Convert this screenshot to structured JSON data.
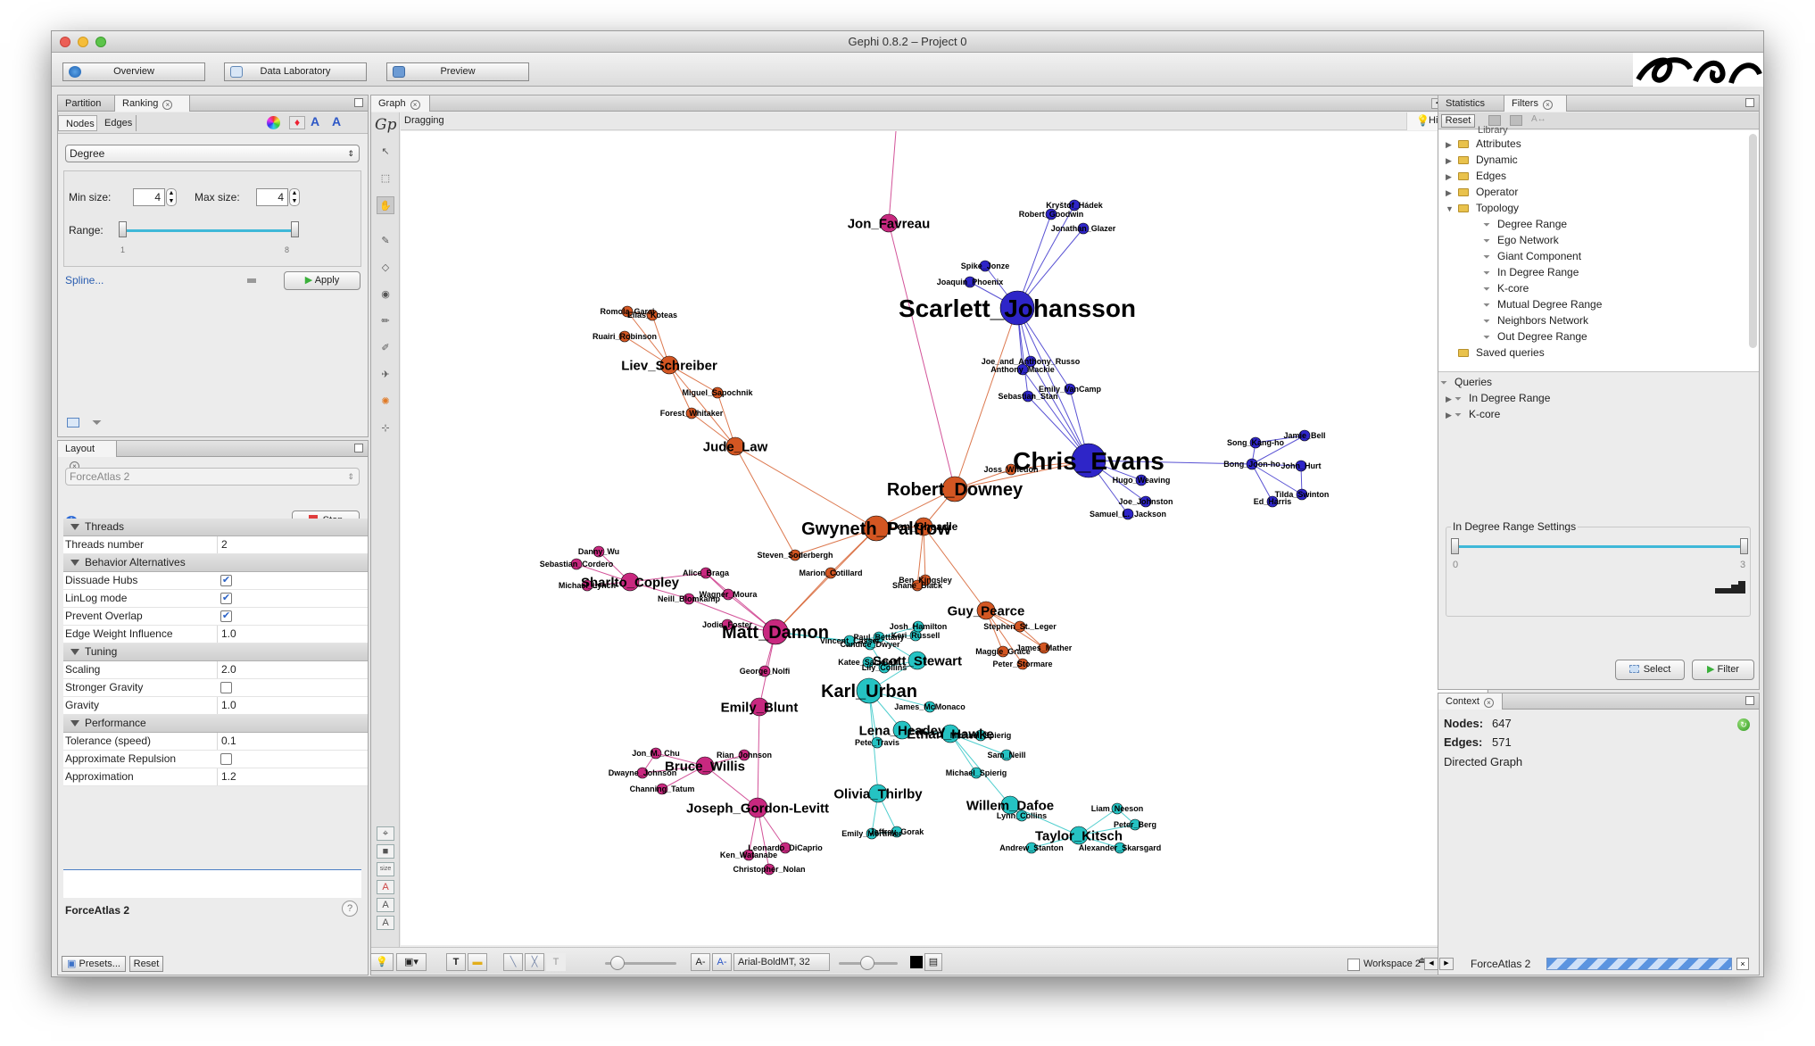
{
  "window": {
    "title": "Gephi 0.8.2 – Project 0"
  },
  "toolbar": {
    "overview": "Overview",
    "data_lab": "Data Laboratory",
    "preview": "Preview"
  },
  "left_top": {
    "tab_partition": "Partition",
    "tab_ranking": "Ranking",
    "subtab_nodes": "Nodes",
    "subtab_edges": "Edges",
    "ranking_select": "Degree",
    "min_size_label": "Min size:",
    "min_size_value": "4",
    "max_size_label": "Max size:",
    "max_size_value": "4",
    "range_label": "Range:",
    "range_min": "1",
    "range_max": "8",
    "spline": "Spline...",
    "apply": "Apply"
  },
  "layout": {
    "tab": "Layout",
    "algorithm": "ForceAtlas 2",
    "stop": "Stop",
    "rows": [
      {
        "kind": "cat",
        "k": "Threads"
      },
      {
        "kind": "prop",
        "k": "Threads number",
        "v": "2"
      },
      {
        "kind": "cat",
        "k": "Behavior Alternatives"
      },
      {
        "kind": "check",
        "k": "Dissuade Hubs",
        "v": "✔"
      },
      {
        "kind": "check",
        "k": "LinLog mode",
        "v": "✔"
      },
      {
        "kind": "check",
        "k": "Prevent Overlap",
        "v": "✔"
      },
      {
        "kind": "prop",
        "k": "Edge Weight Influence",
        "v": "1.0"
      },
      {
        "kind": "cat",
        "k": "Tuning"
      },
      {
        "kind": "prop",
        "k": "Scaling",
        "v": "2.0"
      },
      {
        "kind": "check",
        "k": "Stronger Gravity",
        "v": ""
      },
      {
        "kind": "prop",
        "k": "Gravity",
        "v": "1.0"
      },
      {
        "kind": "cat",
        "k": "Performance"
      },
      {
        "kind": "prop",
        "k": "Tolerance (speed)",
        "v": "0.1"
      },
      {
        "kind": "check",
        "k": "Approximate Repulsion",
        "v": ""
      },
      {
        "kind": "prop",
        "k": "Approximation",
        "v": "1.2"
      }
    ],
    "desc_title": "ForceAtlas 2",
    "presets": "Presets...",
    "reset": "Reset"
  },
  "graph": {
    "tab": "Graph",
    "mode": "Dragging",
    "hierarchy": "Hierarchy",
    "font": "Arial-BoldMT, 32",
    "colors": {
      "magenta": "#c8287f",
      "orange": "#d35622",
      "blue": "#2e25c8",
      "cyan": "#25c3c3"
    },
    "nodes": [
      [
        "Jon_Favreau",
        994,
        254,
        10,
        "magenta",
        15
      ],
      [
        "Scarlett_Johansson",
        1138,
        349,
        19,
        "blue",
        28
      ],
      [
        "Kryštof_Hádek",
        1202,
        234,
        6,
        "blue",
        9
      ],
      [
        "Robert_Goodwin",
        1176,
        244,
        6,
        "blue",
        9
      ],
      [
        "Jonathan_Glazer",
        1212,
        260,
        6,
        "blue",
        9
      ],
      [
        "Spike_Jonze",
        1102,
        302,
        6,
        "blue",
        9
      ],
      [
        "Joaquin_Phoenix",
        1085,
        320,
        6,
        "blue",
        9
      ],
      [
        "Joe_and_Anthony_Russo",
        1153,
        409,
        6,
        "blue",
        9
      ],
      [
        "Anthony_Mackie",
        1144,
        418,
        6,
        "blue",
        9
      ],
      [
        "Emily_VanCamp",
        1197,
        440,
        6,
        "blue",
        9
      ],
      [
        "Sebastian_Stan",
        1150,
        448,
        6,
        "blue",
        9
      ],
      [
        "Chris_Evans",
        1218,
        520,
        19,
        "blue",
        28
      ],
      [
        "Song_Kang-ho",
        1405,
        500,
        6,
        "blue",
        9
      ],
      [
        "Jamie_Bell",
        1460,
        492,
        6,
        "blue",
        9
      ],
      [
        "Bong_Joon-ho",
        1401,
        524,
        6,
        "blue",
        9
      ],
      [
        "John_Hurt",
        1456,
        526,
        6,
        "blue",
        9
      ],
      [
        "Ed_Harris",
        1424,
        566,
        6,
        "blue",
        9
      ],
      [
        "Tilda_Swinton",
        1457,
        558,
        6,
        "blue",
        9
      ],
      [
        "Hugo_Weaving",
        1277,
        542,
        6,
        "blue",
        9
      ],
      [
        "Joe_Johnston",
        1282,
        566,
        6,
        "blue",
        9
      ],
      [
        "Samuel_L._Jackson",
        1262,
        580,
        6,
        "blue",
        9
      ],
      [
        "Romola_Garai",
        701,
        353,
        6,
        "orange",
        9
      ],
      [
        "Elias_Koteas",
        729,
        357,
        6,
        "orange",
        9
      ],
      [
        "Ruairi_Robinson",
        698,
        381,
        6,
        "orange",
        9
      ],
      [
        "Liev_Schreiber",
        748,
        413,
        10,
        "orange",
        15
      ],
      [
        "Miguel_Sapochnik",
        802,
        444,
        6,
        "orange",
        9
      ],
      [
        "Forest_Whitaker",
        773,
        467,
        6,
        "orange",
        9
      ],
      [
        "Jude_Law",
        822,
        504,
        10,
        "orange",
        15
      ],
      [
        "Robert_Downey",
        1068,
        552,
        14,
        "orange",
        20
      ],
      [
        "Joss_Whedon",
        1131,
        530,
        6,
        "orange",
        9
      ],
      [
        "Gwyneth_Paltrow",
        980,
        596,
        14,
        "orange",
        20
      ],
      [
        "Don_Cheadle",
        1033,
        594,
        10,
        "orange",
        12
      ],
      [
        "Steven_Soderbergh",
        889,
        626,
        6,
        "orange",
        9
      ],
      [
        "Marion_Cotillard",
        929,
        646,
        6,
        "orange",
        9
      ],
      [
        "Ben_Kingsley",
        1035,
        654,
        6,
        "orange",
        9
      ],
      [
        "Shane_Black",
        1026,
        660,
        6,
        "orange",
        9
      ],
      [
        "Guy_Pearce",
        1103,
        688,
        10,
        "orange",
        15
      ],
      [
        "Stephen_St._Leger",
        1141,
        706,
        6,
        "orange",
        9
      ],
      [
        "James_Mather",
        1168,
        730,
        6,
        "orange",
        9
      ],
      [
        "Maggie_Grace",
        1122,
        734,
        6,
        "orange",
        9
      ],
      [
        "Peter_Stormare",
        1144,
        748,
        6,
        "orange",
        9
      ],
      [
        "Danny_Wu",
        669,
        622,
        6,
        "magenta",
        9
      ],
      [
        "Sebastian_Cordero",
        644,
        636,
        6,
        "magenta",
        9
      ],
      [
        "Sharlto_Copley",
        704,
        656,
        10,
        "magenta",
        15
      ],
      [
        "Michael_Lynch",
        656,
        660,
        6,
        "magenta",
        9
      ],
      [
        "Alice_Braga",
        789,
        646,
        6,
        "magenta",
        9
      ],
      [
        "Wagner_Moura",
        814,
        670,
        6,
        "magenta",
        9
      ],
      [
        "Neill_Blomkamp",
        770,
        675,
        6,
        "magenta",
        9
      ],
      [
        "Matt_Damon",
        867,
        712,
        14,
        "magenta",
        20
      ],
      [
        "Jodie_Foster",
        813,
        704,
        6,
        "magenta",
        9
      ],
      [
        "George_Nolfi",
        855,
        756,
        6,
        "magenta",
        9
      ],
      [
        "Emily_Blunt",
        849,
        796,
        10,
        "magenta",
        15
      ],
      [
        "Jon_M._Chu",
        733,
        848,
        6,
        "magenta",
        9
      ],
      [
        "Dwayne_Johnson",
        718,
        870,
        6,
        "magenta",
        9
      ],
      [
        "Bruce_Willis",
        788,
        862,
        10,
        "magenta",
        15
      ],
      [
        "Rian_Johnson",
        832,
        850,
        6,
        "magenta",
        9
      ],
      [
        "Channing_Tatum",
        740,
        888,
        6,
        "magenta",
        9
      ],
      [
        "Joseph_Gordon-Levitt",
        847,
        909,
        11,
        "magenta",
        15
      ],
      [
        "Leonardo_DiCaprio",
        878,
        954,
        6,
        "magenta",
        9
      ],
      [
        "Ken_Watanabe",
        837,
        962,
        6,
        "magenta",
        9
      ],
      [
        "Christopher_Nolan",
        860,
        978,
        6,
        "magenta",
        9
      ],
      [
        "Vincent_Cassel",
        950,
        722,
        6,
        "cyan",
        9
      ],
      [
        "Paul_Bettany",
        983,
        718,
        6,
        "cyan",
        9
      ],
      [
        "Keri_Russell",
        1024,
        716,
        6,
        "cyan",
        9
      ],
      [
        "Josh_Hamilton",
        1027,
        706,
        6,
        "cyan",
        9
      ],
      [
        "Candice_Dwyer",
        973,
        726,
        6,
        "cyan",
        9
      ],
      [
        "Katee_Sackhoff",
        971,
        746,
        6,
        "cyan",
        9
      ],
      [
        "Lily_Collins",
        989,
        752,
        6,
        "cyan",
        9
      ],
      [
        "Scott_Stewart",
        1026,
        744,
        10,
        "cyan",
        15
      ],
      [
        "Karl_Urban",
        972,
        778,
        14,
        "cyan",
        20
      ],
      [
        "James_McMonaco",
        1040,
        796,
        6,
        "cyan",
        9
      ],
      [
        "Lena_Headey",
        1009,
        822,
        10,
        "cyan",
        15
      ],
      [
        "Ethan_Hawke",
        1063,
        826,
        10,
        "cyan",
        15
      ],
      [
        "Michael_Spierig",
        1097,
        828,
        6,
        "cyan",
        9
      ],
      [
        "Pete_Travis",
        981,
        836,
        6,
        "cyan",
        9
      ],
      [
        "Sam_Neill",
        1126,
        850,
        6,
        "cyan",
        9
      ],
      [
        "Michael_Spierig",
        1092,
        870,
        6,
        "cyan",
        9
      ],
      [
        "Olivia_Thirlby",
        982,
        893,
        10,
        "cyan",
        15
      ],
      [
        "Emily_Mortimer",
        975,
        938,
        6,
        "cyan",
        9
      ],
      [
        "Jeffrey_Gorak",
        1003,
        936,
        6,
        "cyan",
        9
      ],
      [
        "Willem_Dafoe",
        1130,
        906,
        10,
        "cyan",
        15
      ],
      [
        "Lynn_Collins",
        1143,
        918,
        6,
        "cyan",
        9
      ],
      [
        "Liam_Neeson",
        1250,
        910,
        6,
        "cyan",
        9
      ],
      [
        "Peter_Berg",
        1270,
        928,
        6,
        "cyan",
        9
      ],
      [
        "Taylor_Kitsch",
        1207,
        940,
        10,
        "cyan",
        15
      ],
      [
        "Alexander_Skarsgard",
        1253,
        954,
        6,
        "cyan",
        9
      ],
      [
        "Andrew_Stanton",
        1154,
        954,
        6,
        "cyan",
        9
      ]
    ],
    "edges": [
      [
        0,
        "top",
        "magenta"
      ],
      [
        0,
        28,
        "magenta"
      ],
      [
        1,
        2,
        "blue"
      ],
      [
        1,
        3,
        "blue"
      ],
      [
        1,
        4,
        "blue"
      ],
      [
        1,
        5,
        "blue"
      ],
      [
        1,
        6,
        "blue"
      ],
      [
        1,
        7,
        "blue"
      ],
      [
        1,
        8,
        "blue"
      ],
      [
        1,
        9,
        "blue"
      ],
      [
        1,
        10,
        "blue"
      ],
      [
        1,
        11,
        "blue"
      ],
      [
        11,
        7,
        "blue"
      ],
      [
        11,
        8,
        "blue"
      ],
      [
        11,
        9,
        "blue"
      ],
      [
        11,
        10,
        "blue"
      ],
      [
        11,
        18,
        "blue"
      ],
      [
        11,
        19,
        "blue"
      ],
      [
        11,
        20,
        "blue"
      ],
      [
        11,
        14,
        "blue"
      ],
      [
        14,
        12,
        "blue"
      ],
      [
        14,
        13,
        "blue"
      ],
      [
        14,
        15,
        "blue"
      ],
      [
        14,
        16,
        "blue"
      ],
      [
        14,
        17,
        "blue"
      ],
      [
        12,
        13,
        "blue"
      ],
      [
        15,
        17,
        "blue"
      ],
      [
        1,
        28,
        "orange"
      ],
      [
        11,
        28,
        "orange"
      ],
      [
        11,
        29,
        "orange"
      ],
      [
        28,
        29,
        "orange"
      ],
      [
        21,
        24,
        "orange"
      ],
      [
        22,
        24,
        "orange"
      ],
      [
        23,
        24,
        "orange"
      ],
      [
        21,
        22,
        "orange"
      ],
      [
        24,
        25,
        "orange"
      ],
      [
        24,
        26,
        "orange"
      ],
      [
        24,
        27,
        "orange"
      ],
      [
        25,
        27,
        "orange"
      ],
      [
        26,
        27,
        "orange"
      ],
      [
        27,
        30,
        "orange"
      ],
      [
        27,
        32,
        "orange"
      ],
      [
        28,
        30,
        "orange"
      ],
      [
        28,
        31,
        "orange"
      ],
      [
        30,
        31,
        "orange"
      ],
      [
        30,
        32,
        "orange"
      ],
      [
        30,
        33,
        "orange"
      ],
      [
        31,
        34,
        "orange"
      ],
      [
        31,
        35,
        "orange"
      ],
      [
        34,
        35,
        "orange"
      ],
      [
        31,
        36,
        "orange"
      ],
      [
        36,
        37,
        "orange"
      ],
      [
        36,
        38,
        "orange"
      ],
      [
        36,
        39,
        "orange"
      ],
      [
        36,
        40,
        "orange"
      ],
      [
        37,
        38,
        "orange"
      ],
      [
        33,
        48,
        "orange"
      ],
      [
        30,
        48,
        "orange"
      ],
      [
        48,
        49,
        "magenta"
      ],
      [
        48,
        50,
        "magenta"
      ],
      [
        48,
        46,
        "magenta"
      ],
      [
        48,
        45,
        "magenta"
      ],
      [
        48,
        47,
        "magenta"
      ],
      [
        43,
        47,
        "magenta"
      ],
      [
        43,
        41,
        "magenta"
      ],
      [
        43,
        42,
        "magenta"
      ],
      [
        43,
        44,
        "magenta"
      ],
      [
        43,
        45,
        "magenta"
      ],
      [
        45,
        46,
        "magenta"
      ],
      [
        48,
        51,
        "magenta"
      ],
      [
        51,
        57,
        "magenta"
      ],
      [
        57,
        54,
        "magenta"
      ],
      [
        57,
        58,
        "magenta"
      ],
      [
        57,
        59,
        "magenta"
      ],
      [
        57,
        60,
        "magenta"
      ],
      [
        54,
        52,
        "magenta"
      ],
      [
        54,
        53,
        "magenta"
      ],
      [
        54,
        55,
        "magenta"
      ],
      [
        54,
        56,
        "magenta"
      ],
      [
        52,
        53,
        "magenta"
      ],
      [
        48,
        61,
        "cyan"
      ],
      [
        48,
        65,
        "cyan"
      ],
      [
        61,
        62,
        "cyan"
      ],
      [
        62,
        63,
        "cyan"
      ],
      [
        63,
        64,
        "cyan"
      ],
      [
        65,
        67,
        "cyan"
      ],
      [
        66,
        67,
        "cyan"
      ],
      [
        67,
        68,
        "cyan"
      ],
      [
        68,
        69,
        "cyan"
      ],
      [
        69,
        70,
        "cyan"
      ],
      [
        69,
        71,
        "cyan"
      ],
      [
        69,
        74,
        "cyan"
      ],
      [
        71,
        72,
        "cyan"
      ],
      [
        72,
        73,
        "cyan"
      ],
      [
        72,
        75,
        "cyan"
      ],
      [
        72,
        76,
        "cyan"
      ],
      [
        69,
        77,
        "cyan"
      ],
      [
        77,
        78,
        "cyan"
      ],
      [
        77,
        79,
        "cyan"
      ],
      [
        78,
        79,
        "cyan"
      ],
      [
        72,
        80,
        "cyan"
      ],
      [
        80,
        81,
        "cyan"
      ],
      [
        80,
        84,
        "cyan"
      ],
      [
        84,
        82,
        "cyan"
      ],
      [
        84,
        83,
        "cyan"
      ],
      [
        84,
        85,
        "cyan"
      ],
      [
        84,
        86,
        "cyan"
      ],
      [
        82,
        83,
        "cyan"
      ],
      [
        68,
        62,
        "cyan"
      ],
      [
        62,
        64,
        "cyan"
      ]
    ]
  },
  "filters": {
    "tab_statistics": "Statistics",
    "tab_filters": "Filters",
    "reset": "Reset",
    "library_label": "Library",
    "library": [
      {
        "label": "Attributes",
        "level": 1
      },
      {
        "label": "Dynamic",
        "level": 1
      },
      {
        "label": "Edges",
        "level": 1
      },
      {
        "label": "Operator",
        "level": 1
      },
      {
        "label": "Topology",
        "level": 1,
        "open": true
      },
      {
        "label": "Degree Range",
        "level": 2
      },
      {
        "label": "Ego Network",
        "level": 2
      },
      {
        "label": "Giant Component",
        "level": 2
      },
      {
        "label": "In Degree Range",
        "level": 2
      },
      {
        "label": "K-core",
        "level": 2
      },
      {
        "label": "Mutual Degree Range",
        "level": 2
      },
      {
        "label": "Neighbors Network",
        "level": 2
      },
      {
        "label": "Out Degree Range",
        "level": 2
      },
      {
        "label": "Saved queries",
        "level": 0
      }
    ],
    "queries_label": "Queries",
    "queries": [
      "In Degree Range",
      "K-core"
    ],
    "settings_title": "In Degree Range Settings",
    "range_min": "0",
    "range_max": "3",
    "select": "Select",
    "filter": "Filter"
  },
  "context": {
    "tab": "Context",
    "nodes_label": "Nodes:",
    "nodes_value": "647",
    "edges_label": "Edges:",
    "edges_value": "571",
    "graph_type": "Directed Graph"
  },
  "statusbar": {
    "workspace": "Workspace 2",
    "task": "ForceAtlas 2"
  }
}
